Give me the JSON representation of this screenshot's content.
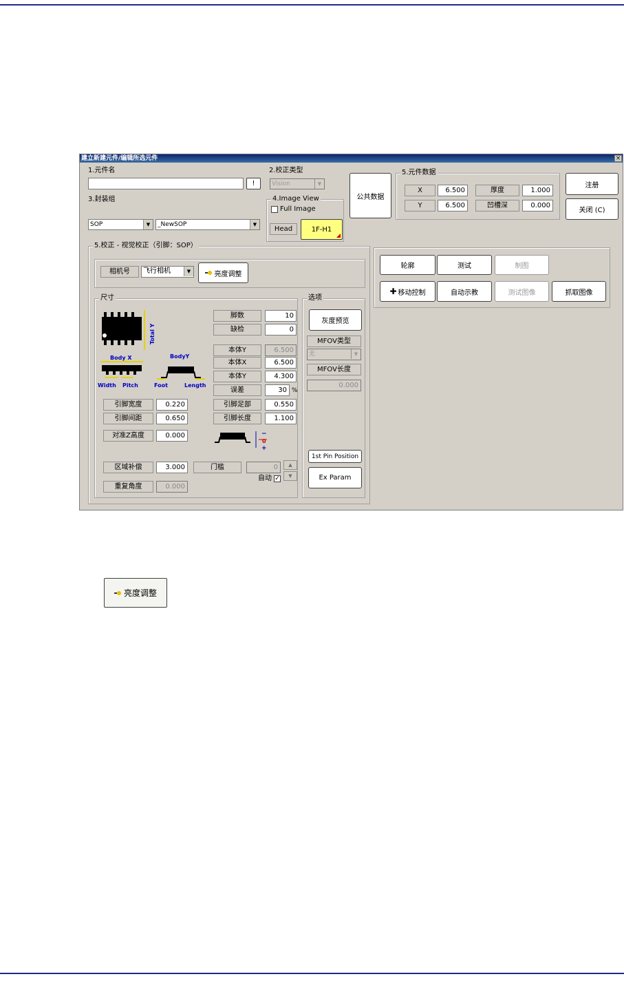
{
  "window": {
    "title": "建立新建元件/编辑所选元件",
    "close_glyph": "×"
  },
  "part_name": {
    "label": "1.元件名",
    "value": "",
    "button": "!"
  },
  "calib_type": {
    "label": "2.校正类型",
    "value": "Vision"
  },
  "package_group": {
    "label": "3.封装组",
    "package": "SOP",
    "name": "_NewSOP"
  },
  "image_view": {
    "label": "4.Image View",
    "full_image_label": "Full Image",
    "head_label": "Head",
    "head_value": "1F-H1"
  },
  "common_data_button": "公共数据",
  "part_data": {
    "title": "5.元件数据",
    "x_label": "X",
    "x_value": "6.500",
    "y_label": "Y",
    "y_value": "6.500",
    "thickness_label": "厚度",
    "thickness_value": "1.000",
    "recess_label": "凹槽深",
    "recess_value": "0.000"
  },
  "register_button": "注册",
  "close_button": "关闭 (C)",
  "calibration": {
    "title": "5.校正 - 视觉校正（引脚：SOP）",
    "camera_label": "相机号",
    "camera_value": "飞行相机",
    "brightness_button": "亮度调整"
  },
  "dimensions": {
    "title": "尺寸",
    "pin_count_label": "脚数",
    "pin_count_value": "10",
    "missing_label": "缺检",
    "missing_value": "0",
    "body_y1_label": "本体Y",
    "body_y1_value": "6.500",
    "body_x_label": "本体X",
    "body_x_value": "6.500",
    "body_y2_label": "本体Y",
    "body_y2_value": "4.300",
    "tolerance_label": "误差",
    "tolerance_value": "30",
    "tolerance_unit": "%",
    "lead_foot_label": "引脚足部",
    "lead_foot_value": "0.550",
    "lead_length_label": "引脚长度",
    "lead_length_value": "1.100",
    "lead_width_label": "引脚宽度",
    "lead_width_value": "0.220",
    "lead_pitch_label": "引脚间距",
    "lead_pitch_value": "0.650",
    "align_z_label": "对准Z高度",
    "align_z_value": "0.000",
    "area_comp_label": "区域补偿",
    "area_comp_value": "3.000",
    "threshold_label": "门槛",
    "threshold_value": "0",
    "auto_label": "自动",
    "repeat_angle_label": "重复角度",
    "repeat_angle_value": "0.000",
    "diagram": {
      "total_y": "Total Y",
      "body_x": "Body X",
      "body_y": "BodyY",
      "width": "Width",
      "pitch": "Pitch",
      "foot": "Foot",
      "length": "Length",
      "minus": "−",
      "zero": "0",
      "plus": "+"
    }
  },
  "options": {
    "title": "选项",
    "gray_preview": "灰度预览",
    "mfov_type_label": "MFOV类型",
    "mfov_type_value": "无",
    "mfov_length_label": "MFOV长度",
    "mfov_length_value": "0.000",
    "first_pin": "1st Pin Position",
    "ex_param": "Ex Param"
  },
  "actions": {
    "outline": "轮廓",
    "test": "测试",
    "draw": "制图",
    "move_control": "移动控制",
    "auto_teach": "自动示教",
    "test_image": "测试图像",
    "grab_image": "抓取图像"
  },
  "callout_button": "亮度调整",
  "colors": {
    "title_bar": "#0a246a",
    "dialog_bg": "#d4d0c8",
    "rule": "#1b2a8c",
    "head_button": "#ffff80",
    "diagram_blue": "#0000c0",
    "diagram_yellow": "#e8d000"
  }
}
